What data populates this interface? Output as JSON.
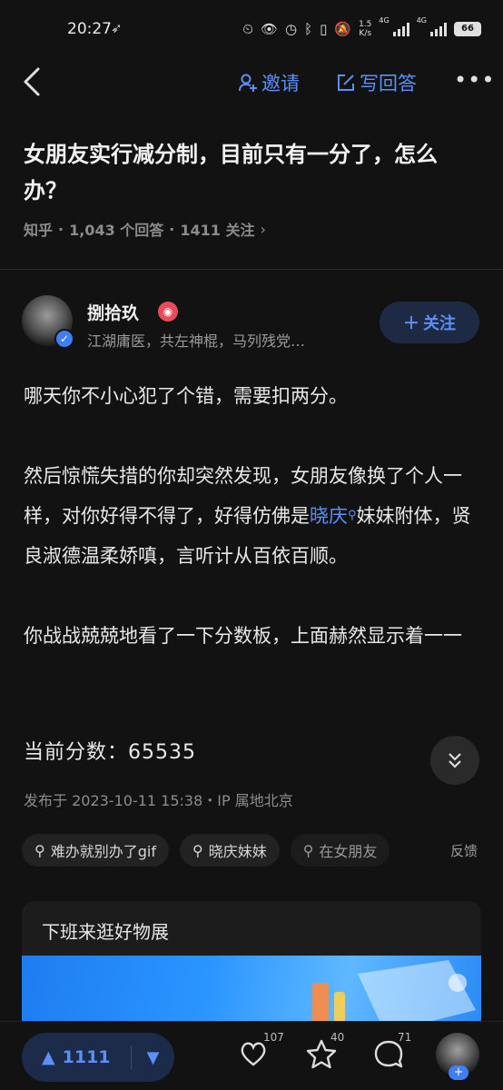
{
  "status_bar": {
    "time": "20:27",
    "net_speed_top": "1.5",
    "net_speed_bottom": "K/s",
    "net_type_1": "4G",
    "net_type_2": "4G",
    "battery": "66"
  },
  "topbar": {
    "invite_label": "邀请",
    "write_answer_label": "写回答",
    "more_label": "•••"
  },
  "question": {
    "title": "女朋友实行减分制，目前只有一分了，怎么办？",
    "source": "知乎",
    "answers": "1,043 个回答",
    "followers": "1411 关注",
    "dot": "·"
  },
  "author": {
    "name": "捌拾玖",
    "description": "江湖庸医，共左神棍，马列残党…",
    "follow_label": "关注",
    "follow_plus": "＋"
  },
  "answer": {
    "p1": "哪天你不小心犯了个错，需要扣两分。",
    "p2_a": "然后惊慌失措的你却突然发现，女朋友像换了个人一样，对你好得不得了，好得仿佛是",
    "p2_link": "晓庆",
    "p2_b": "妹妹附体，贤良淑德温柔娇嗔，言听计从百依百顺。",
    "p3": "你战战兢兢地看了一下分数板，上面赫然显示着一一",
    "score": "当前分数：65535",
    "published": "发布于 2023-10-11 15:38・IP 属地北京"
  },
  "tags": [
    {
      "label": "难办就别办了gif"
    },
    {
      "label": "晓庆妹妹"
    },
    {
      "label": "在女朋友"
    }
  ],
  "feedback_label": "反馈",
  "ad": {
    "title": "下班来逛好物展"
  },
  "bottom": {
    "upvotes": "1111",
    "likes": "107",
    "favorites": "40",
    "comments": "71"
  },
  "colors": {
    "background": "#121212",
    "accent": "#5b8ff9",
    "muted": "#8c8c8c"
  }
}
